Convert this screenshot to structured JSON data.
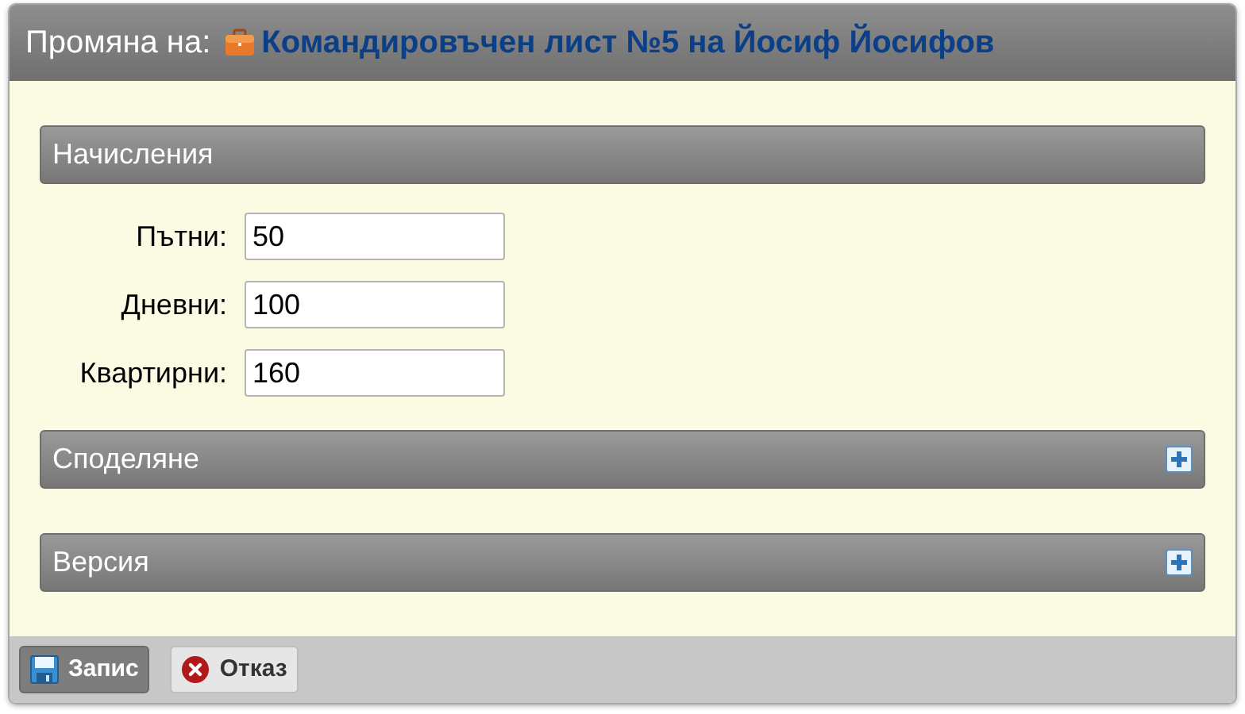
{
  "window": {
    "title_prefix": "Промяна на:",
    "title": "Командировъчен лист №5 на Йосиф Йосифов"
  },
  "sections": [
    {
      "title": "Начисления",
      "expanded": true,
      "fields": [
        {
          "label": "Пътни:",
          "value": "50"
        },
        {
          "label": "Дневни:",
          "value": "100"
        },
        {
          "label": "Квартирни:",
          "value": "160"
        }
      ]
    },
    {
      "title": "Споделяне",
      "expanded": false
    },
    {
      "title": "Версия",
      "expanded": false
    }
  ],
  "buttons": [
    {
      "label": "Запис",
      "kind": "save",
      "highlighted": true
    },
    {
      "label": "Отказ",
      "kind": "cancel",
      "highlighted": false
    }
  ]
}
